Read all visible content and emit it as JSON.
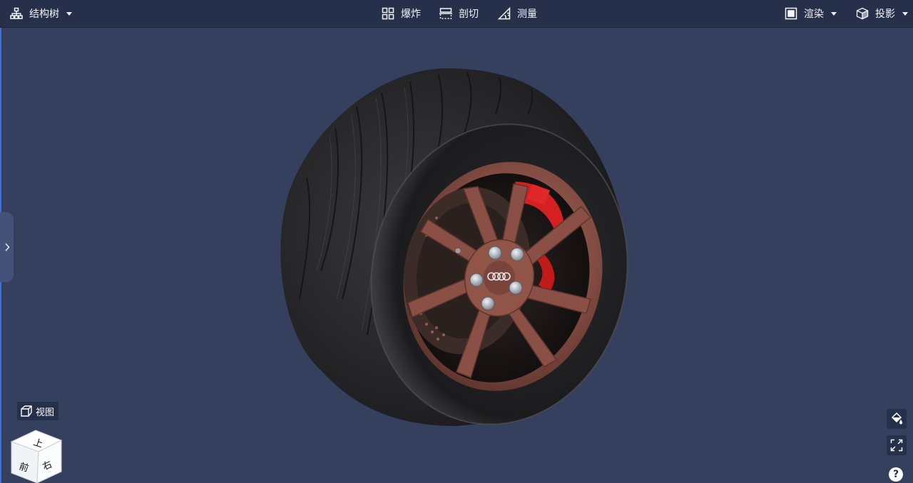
{
  "toolbar": {
    "structure_tree": {
      "label": "结构树",
      "icon": "structure-tree-icon"
    },
    "explode": {
      "label": "爆炸",
      "icon": "explode-icon"
    },
    "section": {
      "label": "剖切",
      "icon": "section-cut-icon"
    },
    "measure": {
      "label": "测量",
      "icon": "measure-icon"
    },
    "render": {
      "label": "渲染",
      "icon": "render-icon"
    },
    "projection": {
      "label": "投影",
      "icon": "projection-icon"
    }
  },
  "view_panel": {
    "label": "视图",
    "icon": "view-cube-icon"
  },
  "view_cube": {
    "faces": [
      "上",
      "前",
      "右"
    ]
  },
  "right_tools": [
    {
      "name": "paint-bucket-icon"
    },
    {
      "name": "fullscreen-icon"
    }
  ],
  "help": {
    "label": "?"
  },
  "model": {
    "name": "wheel-model",
    "rim_color": "#8a4f45",
    "caliper_color": "#d42020",
    "tire_color": "#1e1e20"
  },
  "colors": {
    "toolbar_bg": "#27304a",
    "viewport_bg": "#34405e",
    "accent": "#3e6fe0"
  }
}
